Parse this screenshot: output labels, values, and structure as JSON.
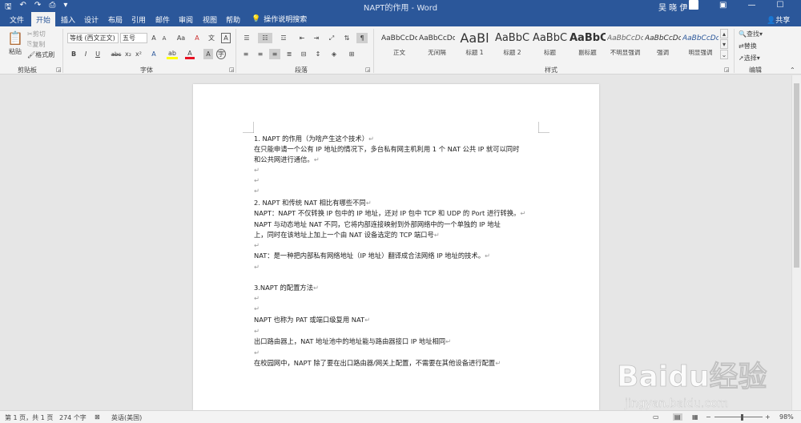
{
  "window": {
    "title": "NAPT的作用 - Word",
    "user": "吴 晓 伊",
    "qat": [
      "save-icon",
      "undo-icon",
      "redo-icon",
      "print-preview-icon",
      "customize-icon"
    ],
    "window_buttons": [
      "—",
      "☐",
      "✕"
    ]
  },
  "tabs": [
    "文件",
    "开始",
    "插入",
    "设计",
    "布局",
    "引用",
    "邮件",
    "审阅",
    "视图",
    "帮助"
  ],
  "active_tab": "开始",
  "tell_me": "操作说明搜索",
  "share": "共享",
  "ribbon": {
    "clipboard": {
      "paste": "粘贴",
      "cut": "剪切",
      "copy": "复制",
      "format_painter": "格式刷",
      "label": "剪贴板"
    },
    "font": {
      "font_name": "等线 (西文正文)",
      "font_size": "五号",
      "grow": "A",
      "shrink": "A",
      "case": "Aa",
      "clear": "A",
      "phonetic": "文",
      "border_char": "A",
      "bold": "B",
      "italic": "I",
      "underline": "U",
      "strike": "abc",
      "sub": "x₂",
      "sup": "x²",
      "effects": "A",
      "highlight": "ab",
      "color": "A",
      "shading": "A",
      "enclose": "字",
      "label": "字体"
    },
    "paragraph": {
      "label": "段落"
    },
    "styles": {
      "label": "样式",
      "items": [
        {
          "sample": "AaBbCcDc",
          "name": "正文"
        },
        {
          "sample": "AaBbCcDc",
          "name": "无间隔"
        },
        {
          "sample": "AaBl",
          "name": "标题 1"
        },
        {
          "sample": "AaBbC",
          "name": "标题 2"
        },
        {
          "sample": "AaBbC",
          "name": "标题"
        },
        {
          "sample": "AaBbC",
          "name": "副标题"
        },
        {
          "sample": "AaBbCcDc",
          "name": "不明显强调"
        },
        {
          "sample": "AaBbCcDc",
          "name": "强调"
        },
        {
          "sample": "AaBbCcDc",
          "name": "明显强调"
        }
      ]
    },
    "editing": {
      "find": "查找",
      "replace": "替换",
      "select": "选择",
      "label": "编辑"
    }
  },
  "document": {
    "lines": [
      "1.   NAPT 的作用（为啥产生这个技术）",
      "在只能申请一个公有 IP 地址的情况下，多台私有网主机利用 1 个 NAT 公共 IP 就可以同时",
      "和公共网进行通信。",
      "",
      "",
      "",
      "2.   NAPT 和传统 NAT 相比有哪些不同",
      "NAPT：NAPT 不仅转换 IP 包中的 IP 地址，还对 IP 包中 TCP 和 UDP 的 Port 进行转换。",
      "        NAPT 与动态地址 NAT 不同，它将内部连接映射到外部网络中的一个单独的 IP 地址",
      "上，同时在该地址上加上一个由 NAT 设备选定的 TCP 端口号",
      "",
      "NAT：是一种把内部私有网络地址（IP 地址）翻译成合法网络 IP 地址的技术。",
      "",
      "3.NAPT 的配置方法",
      "",
      "",
      "NAPT 也称为 PAT 或端口级复用 NAT",
      "",
      "出口路由器上，NAT 地址池中的地址能与路由器接口 IP 地址相同",
      "",
      "在校园网中，NAPT 除了要在出口路由器/网关上配置，不需要在其他设备进行配置"
    ],
    "pilcrow": "↵"
  },
  "status": {
    "page": "第 1 页，共 1 页",
    "words": "274 个字",
    "language": "英语(美国)",
    "zoom": "98%",
    "zoom_minus": "−",
    "zoom_plus": "+"
  },
  "watermark": {
    "logo": "Baidu经验",
    "url": "jingyan.baidu.com"
  },
  "colors": {
    "accent": "#2b579a",
    "highlight": "#ffff00",
    "font_color": "#e81123"
  }
}
